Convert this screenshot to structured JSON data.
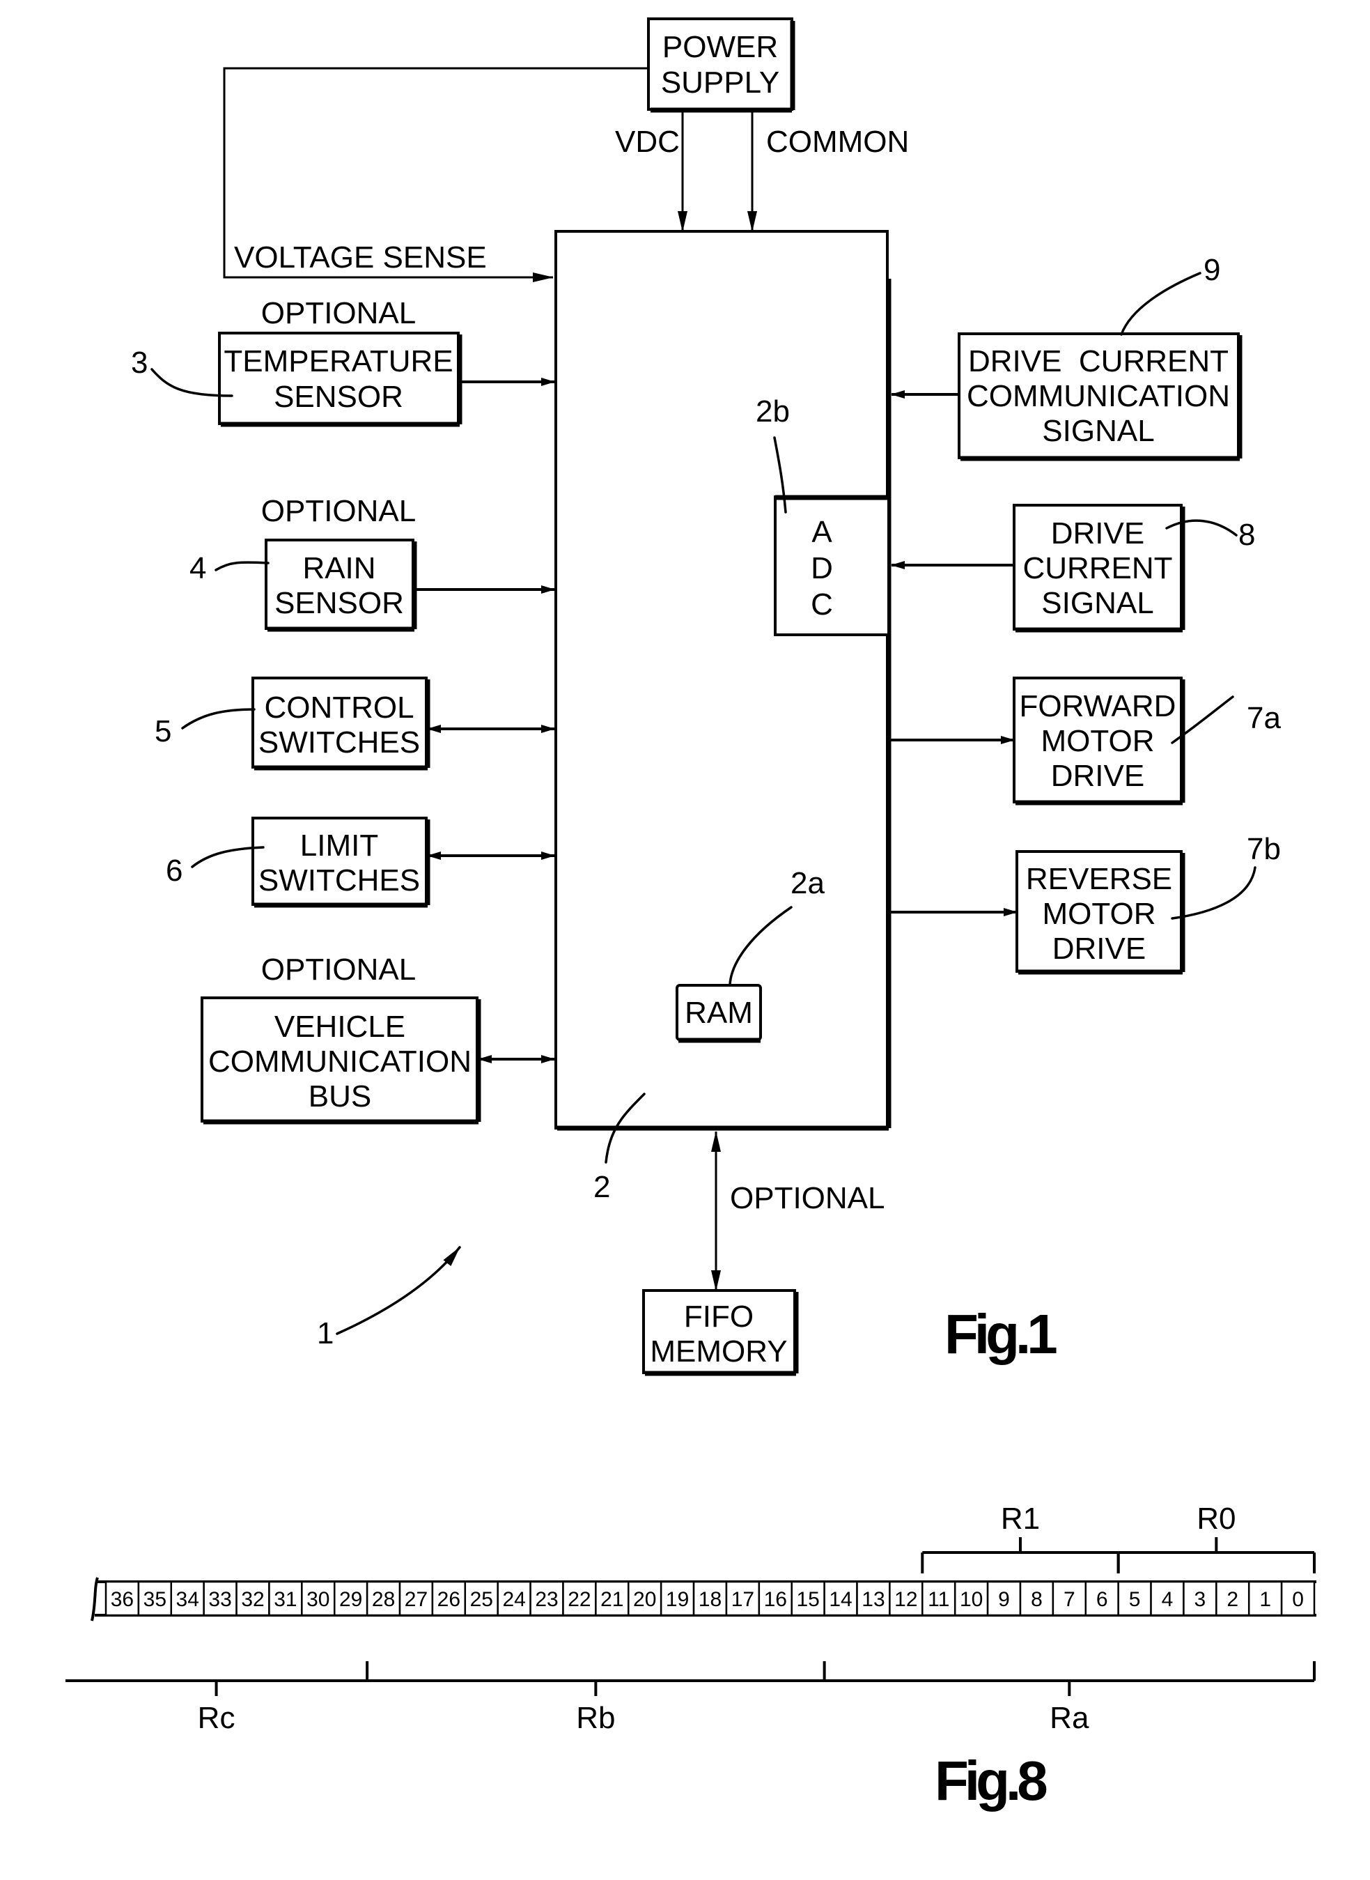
{
  "figure1": {
    "caption": "Fig.1",
    "power_supply": {
      "lines": [
        "POWER",
        "SUPPLY"
      ]
    },
    "signals": {
      "vdc": "VDC",
      "common": "COMMON",
      "voltage_sense": "VOLTAGE SENSE",
      "fifo_optional": "OPTIONAL"
    },
    "left_blocks": [
      {
        "id": "temperature",
        "ref": "3",
        "optional": "OPTIONAL",
        "lines": [
          "TEMPERATURE",
          "SENSOR"
        ],
        "direction": "to-controller"
      },
      {
        "id": "rain",
        "ref": "4",
        "optional": "OPTIONAL",
        "lines": [
          "RAIN",
          "SENSOR"
        ],
        "direction": "to-controller"
      },
      {
        "id": "control-switches",
        "ref": "5",
        "optional": "",
        "lines": [
          "CONTROL",
          "SWITCHES"
        ],
        "direction": "bidirectional"
      },
      {
        "id": "limit-switches",
        "ref": "6",
        "optional": "",
        "lines": [
          "LIMIT",
          "SWITCHES"
        ],
        "direction": "bidirectional"
      },
      {
        "id": "vehicle-bus",
        "ref": "",
        "optional": "OPTIONAL",
        "lines": [
          "VEHICLE",
          "COMMUNICATION",
          "BUS"
        ],
        "direction": "bidirectional"
      }
    ],
    "right_blocks": [
      {
        "id": "drive-current-comm",
        "ref": "9",
        "lines": [
          "DRIVE  CURRENT",
          "COMMUNICATION",
          "SIGNAL"
        ],
        "direction": "to-controller"
      },
      {
        "id": "drive-current-signal",
        "ref": "8",
        "lines": [
          "DRIVE",
          "CURRENT",
          "SIGNAL"
        ],
        "direction": "to-controller"
      },
      {
        "id": "forward-motor",
        "ref": "7a",
        "lines": [
          "FORWARD",
          "MOTOR",
          "DRIVE"
        ],
        "direction": "from-controller"
      },
      {
        "id": "reverse-motor",
        "ref": "7b",
        "lines": [
          "REVERSE",
          "MOTOR",
          "DRIVE"
        ],
        "direction": "from-controller"
      }
    ],
    "controller": {
      "ref": "2",
      "adc": {
        "ref": "2b",
        "letters": [
          "A",
          "D",
          "C"
        ]
      },
      "ram": {
        "ref": "2a",
        "label": "RAM"
      }
    },
    "fifo": {
      "lines": [
        "FIFO",
        "MEMORY"
      ]
    },
    "system_ref": "1"
  },
  "figure8": {
    "caption": "Fig.8",
    "bits": [
      36,
      35,
      34,
      33,
      32,
      31,
      30,
      29,
      28,
      27,
      26,
      25,
      24,
      23,
      22,
      21,
      20,
      19,
      18,
      17,
      16,
      15,
      14,
      13,
      12,
      11,
      10,
      9,
      8,
      7,
      6,
      5,
      4,
      3,
      2,
      1,
      0
    ],
    "upper_groups": [
      {
        "label": "R1",
        "from_bit": 11,
        "to_bit": 6
      },
      {
        "label": "R0",
        "from_bit": 5,
        "to_bit": 0
      }
    ],
    "lower_groups": [
      {
        "label": "Rc",
        "from_bit": 36,
        "to_bit": 29
      },
      {
        "label": "Rb",
        "from_bit": 28,
        "to_bit": 15
      },
      {
        "label": "Ra",
        "from_bit": 14,
        "to_bit": 0
      }
    ]
  }
}
